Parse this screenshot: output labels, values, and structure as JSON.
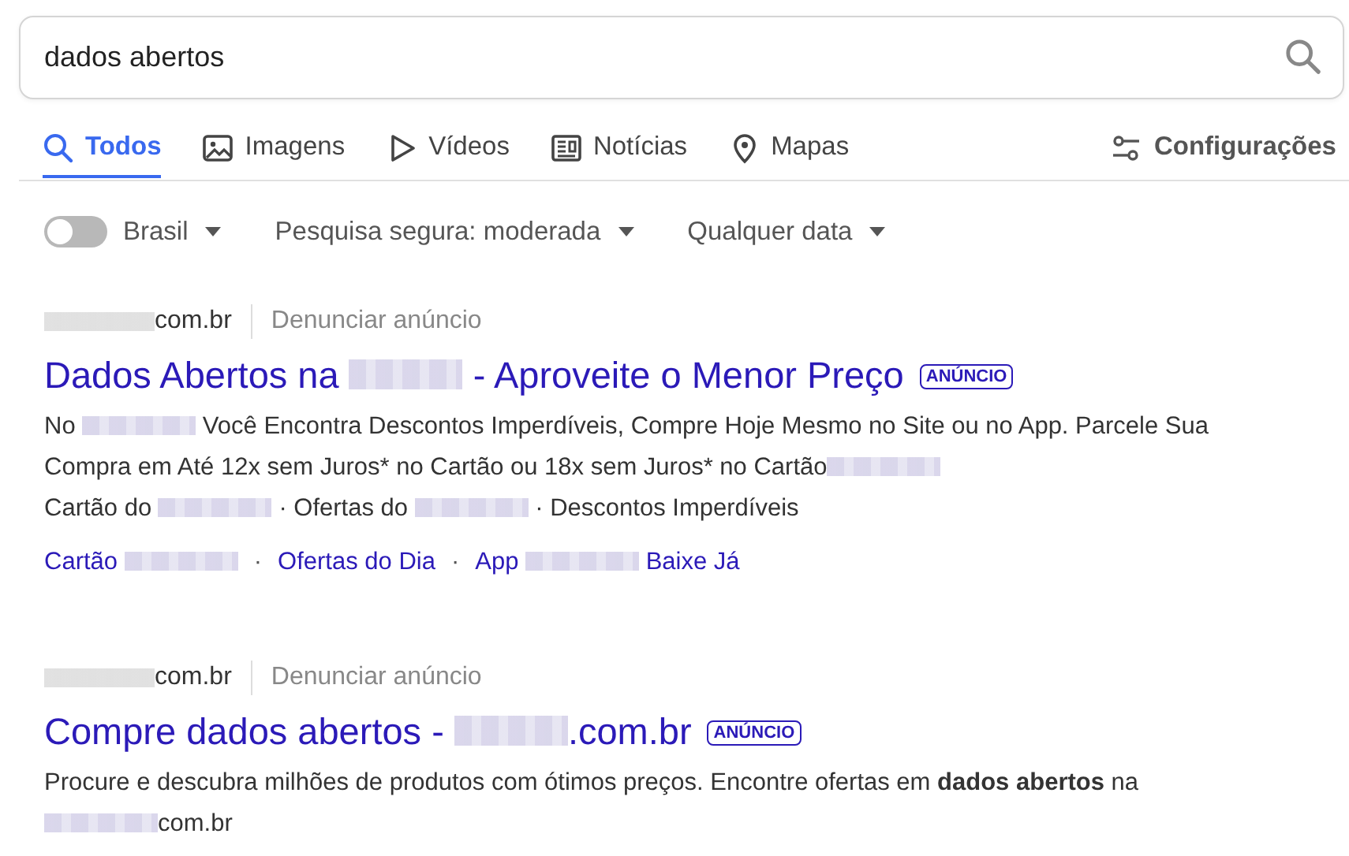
{
  "search": {
    "value": "dados abertos"
  },
  "tabs": [
    {
      "label": "Todos",
      "selected": true
    },
    {
      "label": "Imagens",
      "selected": false
    },
    {
      "label": "Vídeos",
      "selected": false
    },
    {
      "label": "Notícias",
      "selected": false
    },
    {
      "label": "Mapas",
      "selected": false
    }
  ],
  "settings": {
    "label": "Configurações"
  },
  "filters": {
    "region": {
      "label": "Brasil",
      "on": false
    },
    "dropdowns": [
      "Pesquisa segura: moderada",
      "Qualquer data"
    ]
  },
  "results": [
    {
      "url_parts": [
        {
          "kind": "blur"
        },
        {
          "kind": "text",
          "text": "com.br"
        }
      ],
      "report": "Denunciar anúncio",
      "title_parts": [
        {
          "kind": "text",
          "text": "Dados Abertos na "
        },
        {
          "kind": "blur"
        },
        {
          "kind": "text",
          "text": " - Aproveite o Menor Preço"
        }
      ],
      "badge": "ANÚNCIO",
      "description": [
        [
          {
            "kind": "text",
            "text": "No "
          },
          {
            "kind": "blur"
          },
          {
            "kind": "text",
            "text": " Você Encontra Descontos Imperdíveis, Compre Hoje Mesmo no Site ou no App. Parcele Sua Compra em Até 12x sem Juros* no Cartão ou 18x sem Juros* no Cartão"
          },
          {
            "kind": "blur"
          }
        ],
        [
          {
            "kind": "text",
            "text": "Cartão do "
          },
          {
            "kind": "blur"
          },
          {
            "kind": "text",
            "text": " · Ofertas do "
          },
          {
            "kind": "blur"
          },
          {
            "kind": "text",
            "text": " · Descontos Imperdíveis"
          }
        ]
      ],
      "sitelinks": [
        {
          "kind": "link",
          "parts": [
            {
              "kind": "text",
              "text": "Cartão "
            },
            {
              "kind": "blur"
            }
          ]
        },
        {
          "kind": "separator",
          "text": "·"
        },
        {
          "kind": "link",
          "parts": [
            {
              "kind": "text",
              "text": "Ofertas do Dia"
            }
          ]
        },
        {
          "kind": "separator",
          "text": "·"
        },
        {
          "kind": "link",
          "parts": [
            {
              "kind": "text",
              "text": "App "
            },
            {
              "kind": "blur"
            },
            {
              "kind": "text",
              "text": " Baixe Já"
            }
          ]
        }
      ]
    },
    {
      "url_parts": [
        {
          "kind": "blur"
        },
        {
          "kind": "text",
          "text": "com.br"
        }
      ],
      "report": "Denunciar anúncio",
      "title_parts": [
        {
          "kind": "text",
          "text": "Compre dados abertos - "
        },
        {
          "kind": "blur"
        },
        {
          "kind": "text",
          "text": ".com.br"
        }
      ],
      "badge": "ANÚNCIO",
      "description": [
        [
          {
            "kind": "text",
            "text": "Procure e descubra milhões de produtos com ótimos preços. Encontre ofertas em **dados abertos** na"
          }
        ],
        [
          {
            "kind": "blur"
          },
          {
            "kind": "text",
            "text": "com.br"
          }
        ]
      ]
    }
  ]
}
